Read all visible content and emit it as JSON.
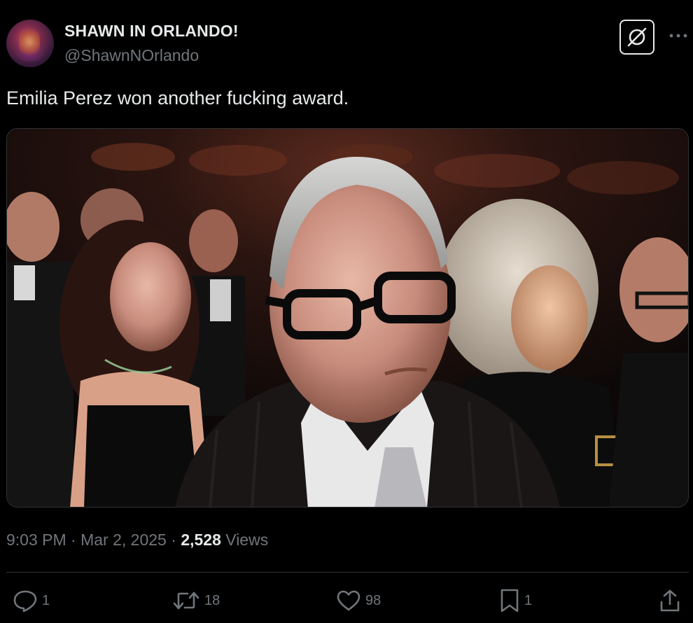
{
  "tweet": {
    "display_name": "SHAWN IN ORLANDO!",
    "handle": "@ShawnNOrlando",
    "text": "Emilia Perez won another fucking award.",
    "image_alt": "Photo of an older man in glasses looking unimpressed in a theater audience, women laughing beside him"
  },
  "meta": {
    "time": "9:03 PM",
    "separator1": " · ",
    "date": "Mar 2, 2025",
    "separator2": " · ",
    "views_count": "2,528",
    "views_label": " Views"
  },
  "actions": {
    "replies": "1",
    "reposts": "18",
    "likes": "98",
    "bookmarks": "1"
  },
  "icons": {
    "grok": "grok-icon",
    "more": "more-icon",
    "reply": "reply-icon",
    "repost": "repost-icon",
    "like": "heart-icon",
    "bookmark": "bookmark-icon",
    "share": "share-icon"
  },
  "colors": {
    "background": "#000000",
    "text_primary": "#e7e9ea",
    "text_secondary": "#71767b",
    "border": "#2f3336"
  }
}
